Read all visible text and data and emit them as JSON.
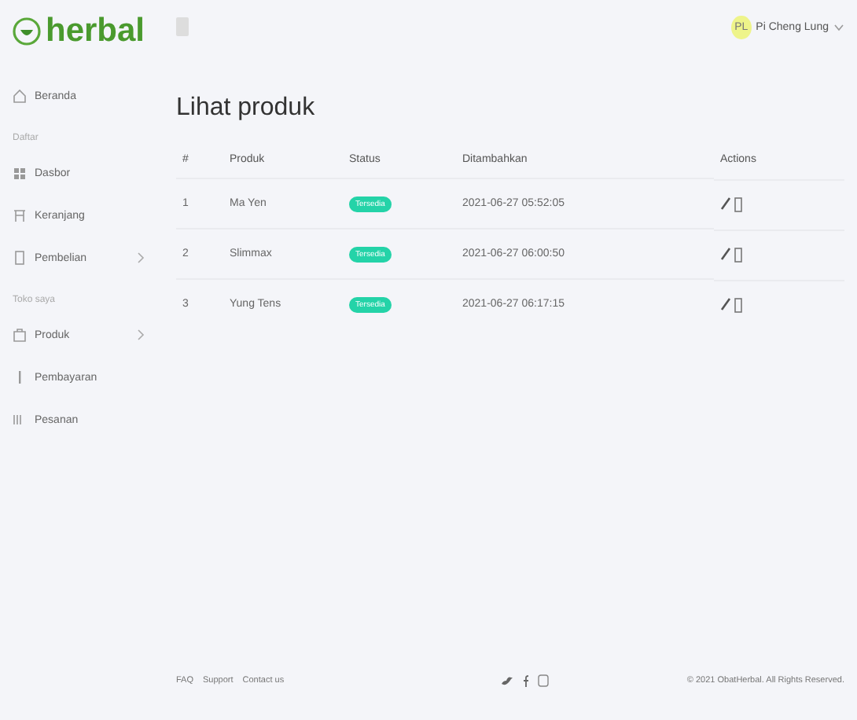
{
  "brand": "herbal",
  "user": {
    "initials": "PL",
    "name": "Pi Cheng Lung"
  },
  "sidebar": {
    "items": [
      {
        "kind": "item",
        "label": "Beranda",
        "expandable": false
      },
      {
        "kind": "section",
        "label": "Daftar"
      },
      {
        "kind": "item",
        "label": "Dasbor",
        "expandable": false
      },
      {
        "kind": "item",
        "label": "Keranjang",
        "expandable": false
      },
      {
        "kind": "item",
        "label": "Pembelian",
        "expandable": true
      },
      {
        "kind": "section",
        "label": "Toko saya"
      },
      {
        "kind": "item",
        "label": "Produk",
        "expandable": true
      },
      {
        "kind": "item",
        "label": "Pembayaran",
        "expandable": false
      },
      {
        "kind": "item",
        "label": "Pesanan",
        "expandable": false
      }
    ]
  },
  "page_title": "Lihat produk",
  "table": {
    "columns": [
      "#",
      "Produk",
      "Status",
      "Ditambahkan",
      "Actions"
    ],
    "rows": [
      {
        "no": "1",
        "product": "Ma Yen",
        "status": "Tersedia",
        "added": "2021-06-27 05:52:05"
      },
      {
        "no": "2",
        "product": "Slimmax",
        "status": "Tersedia",
        "added": "2021-06-27 06:00:50"
      },
      {
        "no": "3",
        "product": "Yung Tens",
        "status": "Tersedia",
        "added": "2021-06-27 06:17:15"
      }
    ]
  },
  "footer": {
    "links": [
      "FAQ",
      "Support",
      "Contact us"
    ],
    "copyright": "© 2021 ObatHerbal. All Rights Reserved."
  }
}
